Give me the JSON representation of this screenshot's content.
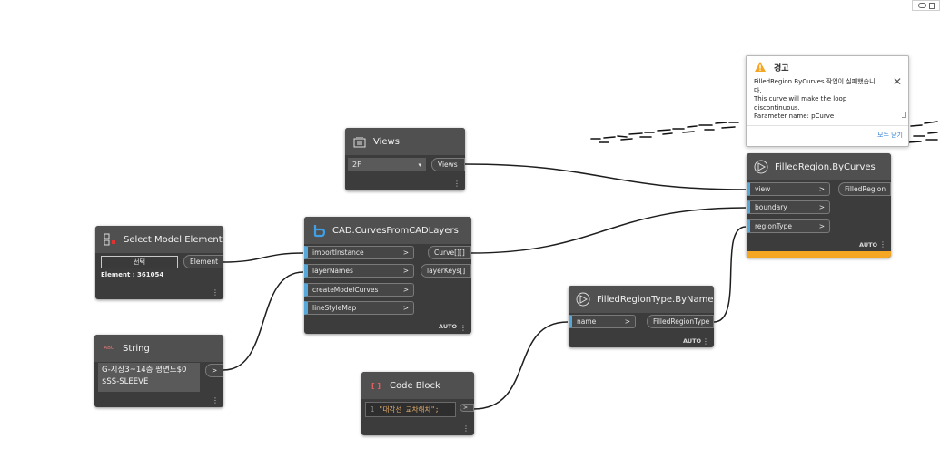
{
  "colors": {
    "canvas": "#ffffff",
    "node_body": "#3c3c3c",
    "node_header": "#505050",
    "port_accent": "#57a8d8",
    "warning_bar": "#f5a623",
    "wire": "#1e1e1e",
    "link": "#2b7fd6"
  },
  "views_node": {
    "title": "Views",
    "icon": "views-icon",
    "dropdown_value": "2F",
    "output": "Views"
  },
  "select_node": {
    "title": "Select Model Element",
    "icon": "select-element-icon",
    "button_label": "선택",
    "status": "Element : 361054",
    "output": "Element"
  },
  "string_node": {
    "title": "String",
    "icon_label": "ABC",
    "value_line1": "G-지상3~14층 평면도$0",
    "value_line2": "$SS-SLEEVE",
    "output": ">"
  },
  "cad_node": {
    "title": "CAD.CurvesFromCADLayers",
    "icon": "cad-logo-icon",
    "inputs": [
      "importInstance",
      "layerNames",
      "createModelCurves",
      "lineStyleMap"
    ],
    "outputs": [
      "Curve[][]",
      "layerKeys[]"
    ],
    "lacing": "AUTO"
  },
  "codeblock_node": {
    "title": "Code Block",
    "icon_label": "[ ]",
    "line_number": "1",
    "code": "\"대각선 교차해치\";",
    "output": ">"
  },
  "frt_node": {
    "title": "FilledRegionType.ByName",
    "icon": "dynamo-node-icon",
    "inputs": [
      "name"
    ],
    "outputs": [
      "FilledRegionType"
    ],
    "lacing": "AUTO"
  },
  "fr_node": {
    "title": "FilledRegion.ByCurves",
    "icon": "dynamo-node-icon",
    "inputs": [
      "view",
      "boundary",
      "regionType"
    ],
    "outputs": [
      "FilledRegion"
    ],
    "lacing": "AUTO"
  },
  "port_arrow": ">",
  "warning": {
    "title": "경고",
    "icon": "warning-triangle-icon",
    "line1": "FilledRegion.ByCurves 작업이 실패했습니",
    "line2": "다.",
    "line3": "This curve will make the loop",
    "line4": "discontinuous.",
    "line5": "Parameter name: pCurve",
    "dismiss_all": "모두 닫기"
  }
}
